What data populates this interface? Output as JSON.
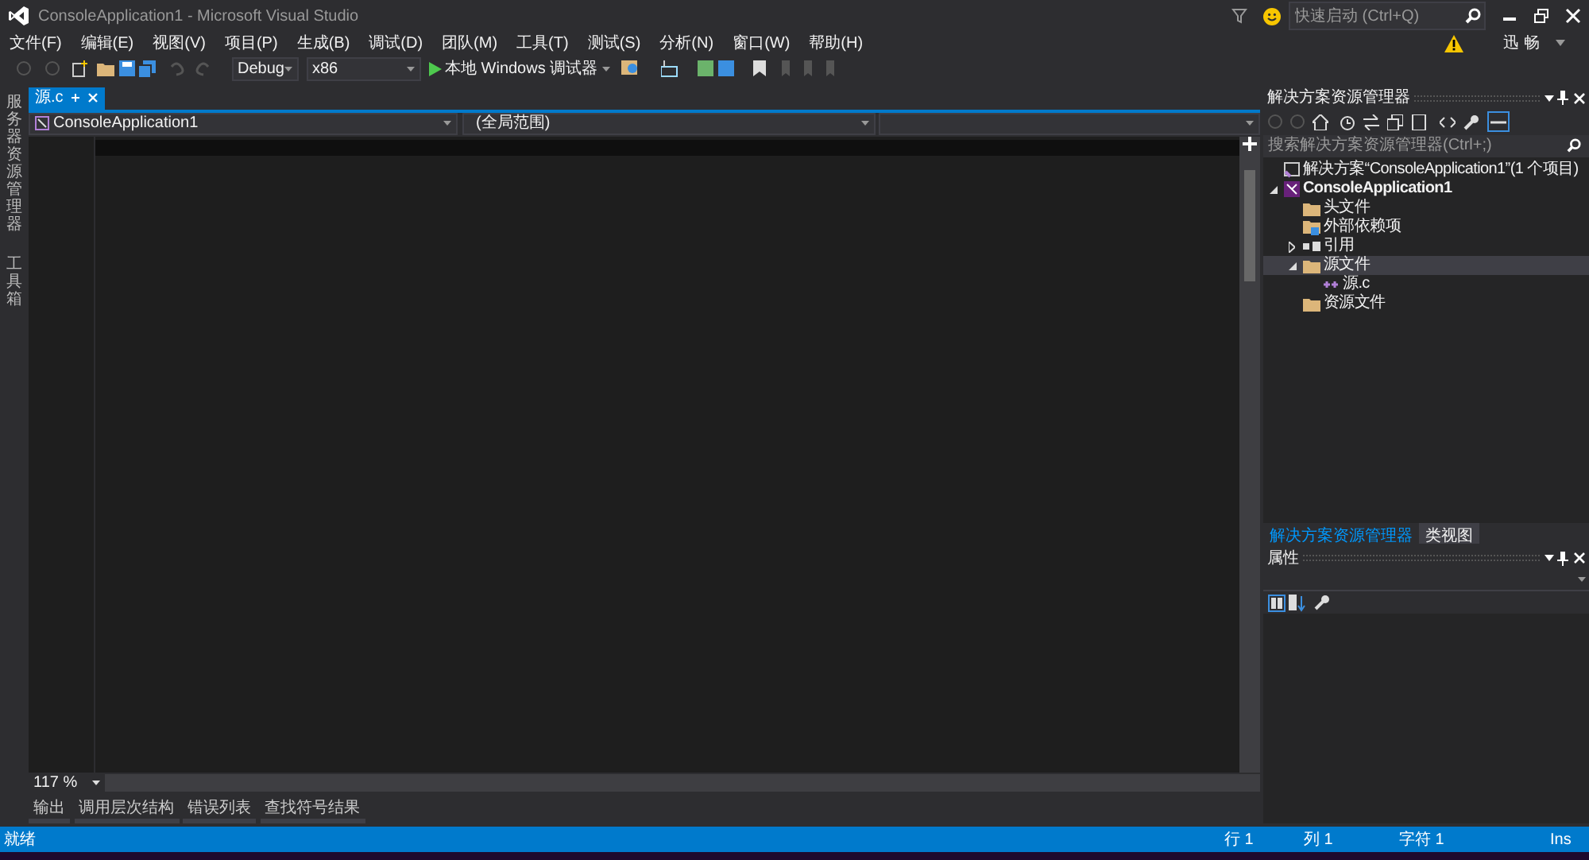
{
  "window": {
    "title": "ConsoleApplication1 - Microsoft Visual Studio",
    "quick_launch": {
      "placeholder": "快速启动 (Ctrl+Q)"
    },
    "user": "迅 畅"
  },
  "menu": [
    "文件(F)",
    "编辑(E)",
    "视图(V)",
    "项目(P)",
    "生成(B)",
    "调试(D)",
    "团队(M)",
    "工具(T)",
    "测试(S)",
    "分析(N)",
    "窗口(W)",
    "帮助(H)"
  ],
  "toolbar": {
    "configuration": "Debug",
    "platform": "x86",
    "run": "本地 Windows 调试器"
  },
  "left_strip": [
    "服务器资源管理器",
    "工具箱"
  ],
  "editor": {
    "tabs": [
      {
        "label": "源.c",
        "selected": true
      }
    ],
    "project": "ConsoleApplication1",
    "scope": "(全局范围)",
    "zoom": "117 %"
  },
  "bottom_tabs": [
    "输出",
    "调用层次结构",
    "错误列表",
    "查找符号结果"
  ],
  "solution_explorer": {
    "title": "解决方案资源管理器",
    "search": {
      "placeholder": "搜索解决方案资源管理器(Ctrl+;)"
    },
    "tree": [
      {
        "kind": "solution",
        "label": "解决方案“ConsoleApplication1”(1 个项目)",
        "selected": false,
        "children": [
          {
            "kind": "project",
            "label": "ConsoleApplication1",
            "expanded": true,
            "selected": false,
            "children": [
              {
                "kind": "folder",
                "label": "头文件",
                "selected": false
              },
              {
                "kind": "dependencies",
                "label": "外部依赖项",
                "selected": false
              },
              {
                "kind": "references",
                "label": "引用",
                "expanded": false,
                "selected": false
              },
              {
                "kind": "folder",
                "label": "源文件",
                "expanded": true,
                "selected": true,
                "children": [
                  {
                    "kind": "file",
                    "label": "源.c",
                    "selected": false
                  }
                ]
              },
              {
                "kind": "folder",
                "label": "资源文件",
                "selected": false
              }
            ]
          }
        ]
      }
    ],
    "tabs": [
      {
        "label": "解决方案资源管理器",
        "selected": true
      },
      {
        "label": "类视图",
        "selected": false
      }
    ]
  },
  "properties": {
    "title": "属性"
  },
  "status_bar": {
    "message": "就绪",
    "line": "行 1",
    "column": "列 1",
    "char": "字符 1",
    "mode": "Ins"
  }
}
